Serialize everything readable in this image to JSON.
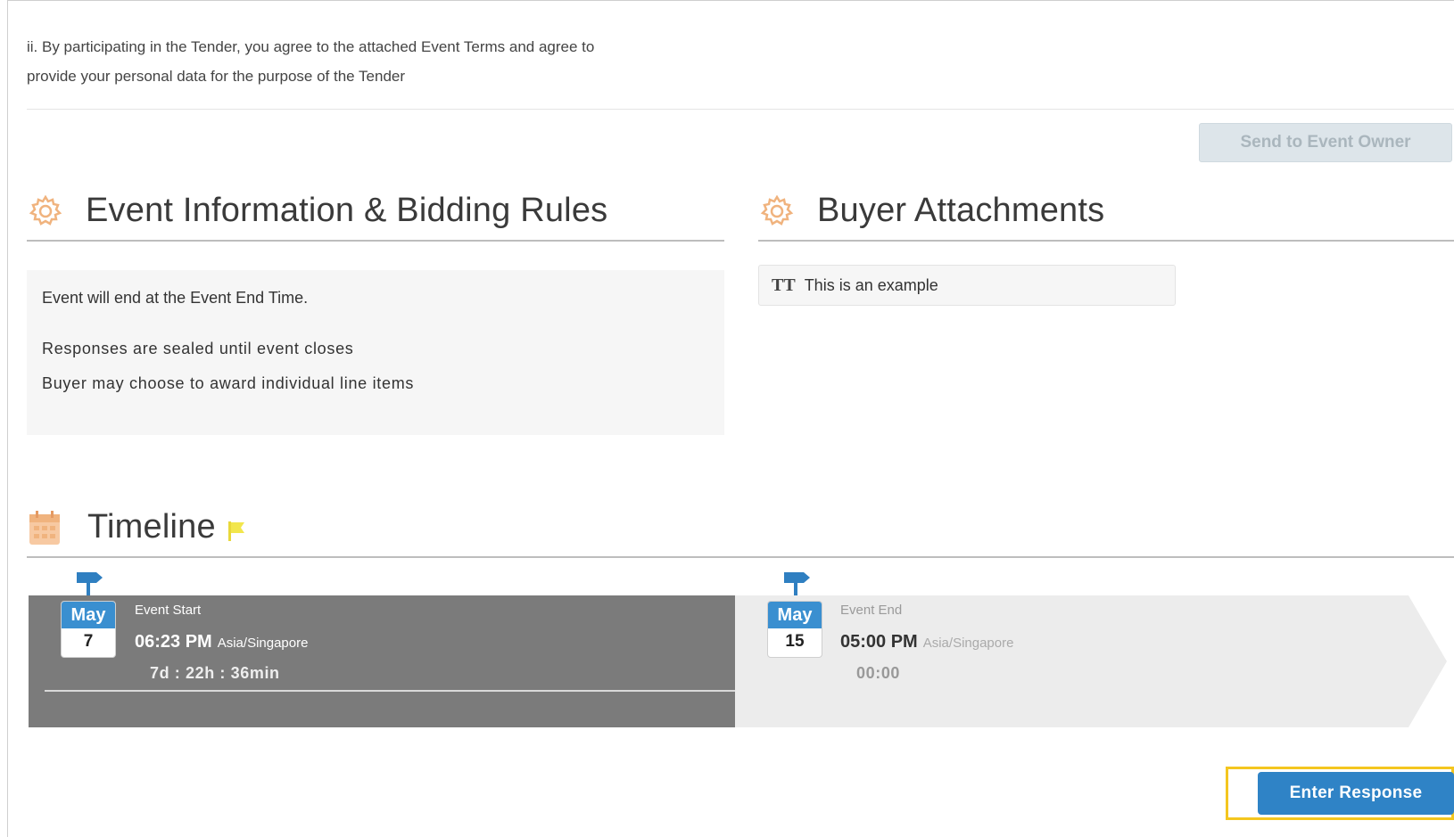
{
  "terms": {
    "line1": "ii. By participating in the Tender, you agree to the attached Event Terms and agree to",
    "line2": "provide your personal data for the purpose of the Tender"
  },
  "send_button": {
    "label": "Send to Event Owner",
    "disabled": true
  },
  "event_info": {
    "title": "Event Information & Bidding Rules",
    "icon": "gear-icon",
    "rules": [
      "Event will end at the Event End Time.",
      "Responses are sealed until event closes",
      "Buyer may choose to award individual line items"
    ]
  },
  "buyer_attachments": {
    "title": "Buyer Attachments",
    "icon": "gear-icon",
    "items": [
      {
        "icon": "text-format-icon",
        "glyph": "TT",
        "label": "This is an example"
      }
    ]
  },
  "timeline": {
    "title": "Timeline",
    "icon": "calendar-icon",
    "flag_icon": "flag-icon",
    "start": {
      "label": "Event Start",
      "month": "May",
      "day": "7",
      "time": "06:23 PM",
      "timezone": "Asia/Singapore",
      "countdown": "7d : 22h : 36min"
    },
    "end": {
      "label": "Event End",
      "month": "May",
      "day": "15",
      "time": "05:00 PM",
      "timezone": "Asia/Singapore",
      "countdown": "00:00"
    }
  },
  "enter_button": {
    "label": "Enter Response"
  },
  "colors": {
    "accent_blue": "#2f83c6",
    "calendar_blue": "#3a8fd0",
    "highlight_yellow": "#f4c61f",
    "icon_orange": "#f0b37e"
  }
}
